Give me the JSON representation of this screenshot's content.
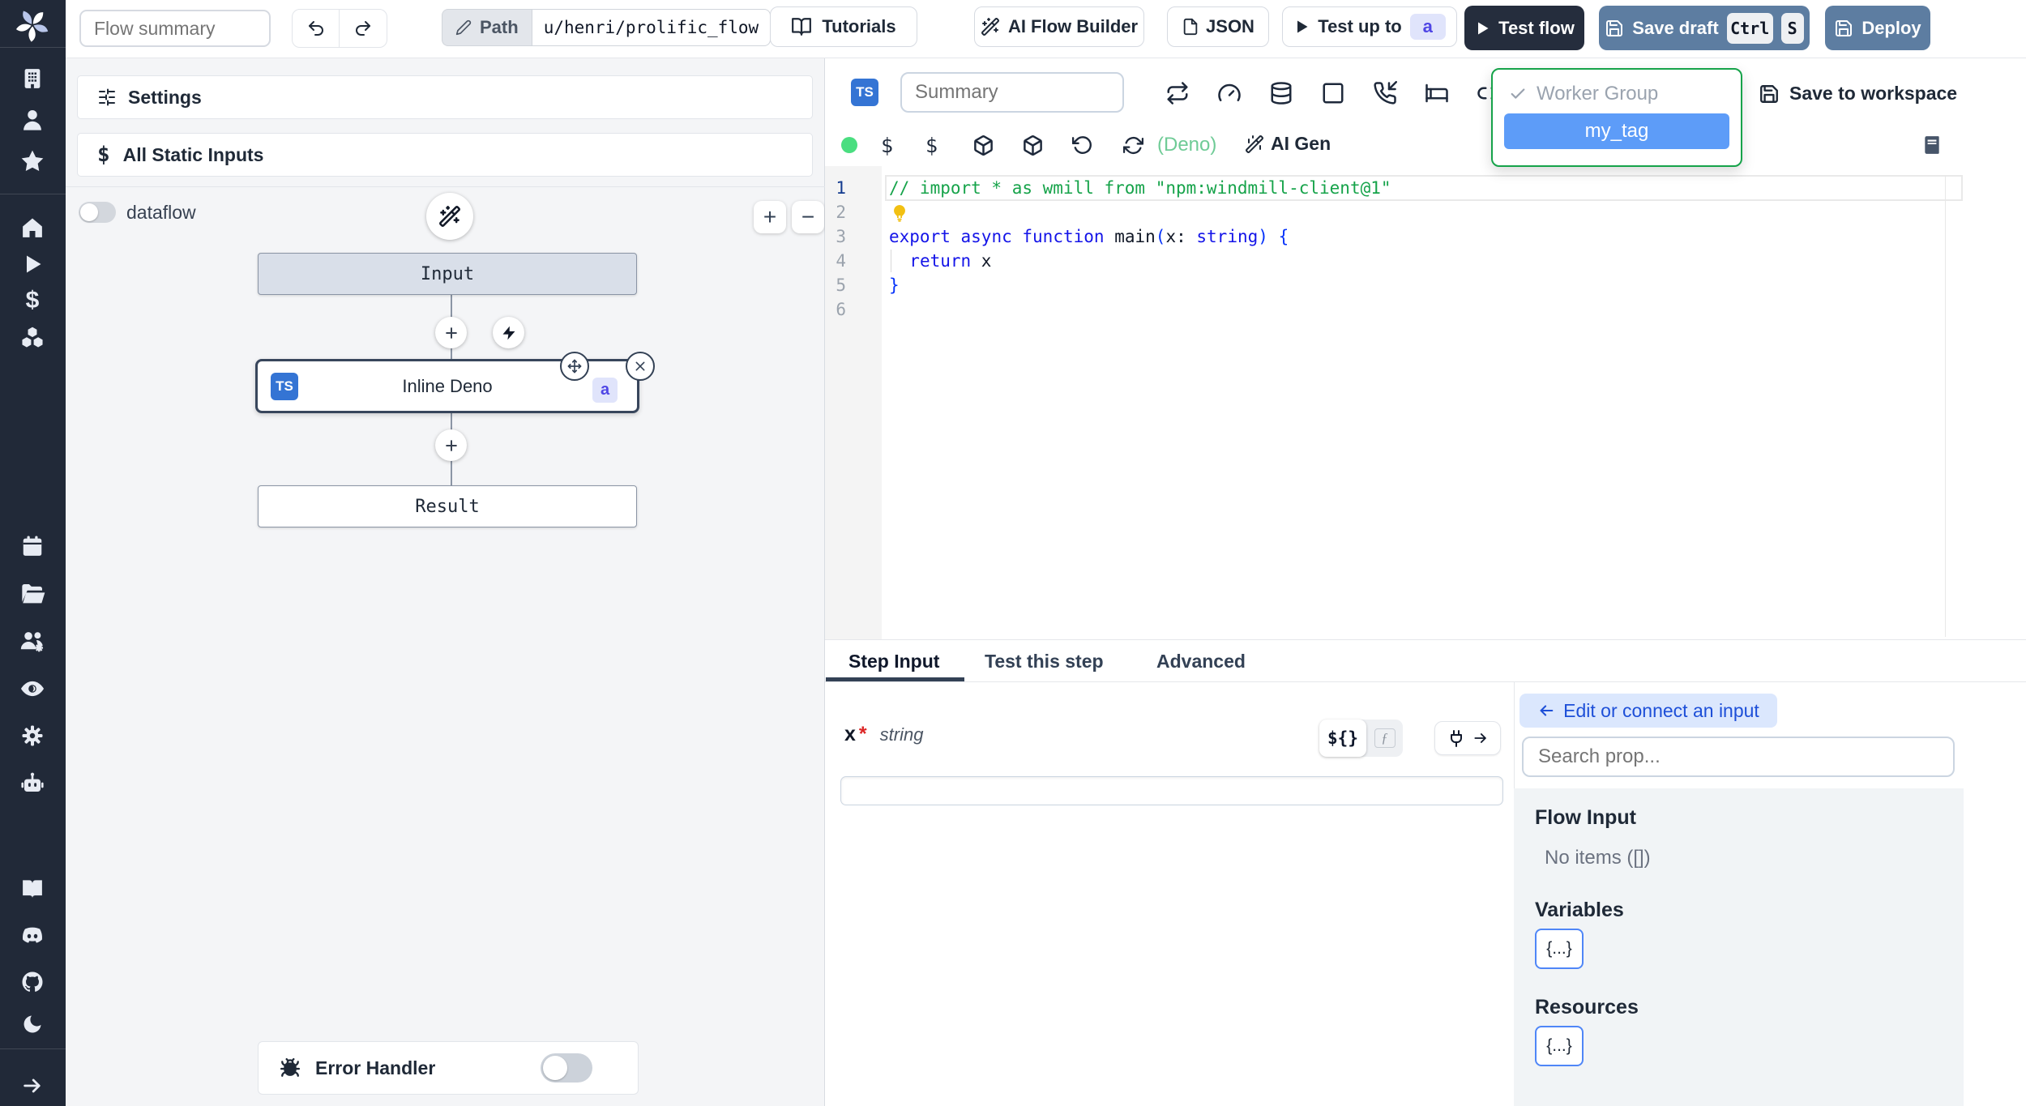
{
  "topbar": {
    "flow_summary_placeholder": "Flow summary",
    "path_label": "Path",
    "path_value": "u/henri/prolific_flow",
    "tutorials": "Tutorials",
    "ai_flow_builder": "AI Flow Builder",
    "json": "JSON",
    "test_up_to": "Test up to",
    "test_up_to_badge": "a",
    "test_flow": "Test flow",
    "save_draft": "Save draft",
    "kbd_ctrl": "Ctrl",
    "kbd_s": "S",
    "deploy": "Deploy"
  },
  "flow_panel": {
    "settings": "Settings",
    "static_inputs_icon": "$",
    "all_static_inputs": "All Static Inputs",
    "dataflow": "dataflow",
    "zoom_in": "+",
    "zoom_out": "−",
    "nodes": {
      "input": "Input",
      "step_lang": "TS",
      "step_label": "Inline Deno",
      "step_badge": "a",
      "result": "Result"
    },
    "error_handler": "Error Handler"
  },
  "editor": {
    "lang_badge": "TS",
    "summary_placeholder": "Summary",
    "worker_group": "Worker Group",
    "worker_tag": "my_tag",
    "save_to_workspace": "Save to workspace",
    "deno": "(Deno)",
    "ai_gen": "AI Gen",
    "code": {
      "lines": [
        {
          "n": 1,
          "active": true,
          "tokens": [
            [
              "c",
              "// import * as wmill from \"npm:windmill-client@1\""
            ]
          ]
        },
        {
          "n": 2,
          "bulb": true,
          "tokens": []
        },
        {
          "n": 3,
          "tokens": [
            [
              "k",
              "export"
            ],
            [
              "p",
              " "
            ],
            [
              "k",
              "async"
            ],
            [
              "p",
              " "
            ],
            [
              "k",
              "function"
            ],
            [
              "p",
              " "
            ],
            [
              "f",
              "main"
            ],
            [
              "b",
              "("
            ],
            [
              "v",
              "x"
            ],
            [
              "p",
              ": "
            ],
            [
              "k",
              "string"
            ],
            [
              "b",
              ")"
            ],
            [
              "p",
              " "
            ],
            [
              "b",
              "{"
            ]
          ]
        },
        {
          "n": 4,
          "tokens": [
            [
              "p",
              "  "
            ],
            [
              "k",
              "return"
            ],
            [
              "p",
              " x"
            ]
          ]
        },
        {
          "n": 5,
          "tokens": [
            [
              "b",
              "}"
            ]
          ]
        },
        {
          "n": 6,
          "tokens": []
        }
      ]
    }
  },
  "step_panel": {
    "tabs": [
      "Step Input",
      "Test this step",
      "Advanced"
    ],
    "arg_name": "x",
    "arg_required": "*",
    "arg_type": "string",
    "toggle_expr": "${}",
    "toggle_fn": "ƒ",
    "connect_button": "Edit or connect an input",
    "search_placeholder": "Search prop...",
    "flow_input": "Flow Input",
    "no_items": "No items ([])",
    "variables": "Variables",
    "resources": "Resources",
    "object_chip": "{...}"
  },
  "colors": {
    "accent_blue": "#3474d4",
    "steel_button": "#5d7da1",
    "dark_button": "#252d3d",
    "tag_highlight": "#5d9cf8",
    "dropdown_ring": "#16a34a",
    "green_dot": "#4ade80"
  }
}
